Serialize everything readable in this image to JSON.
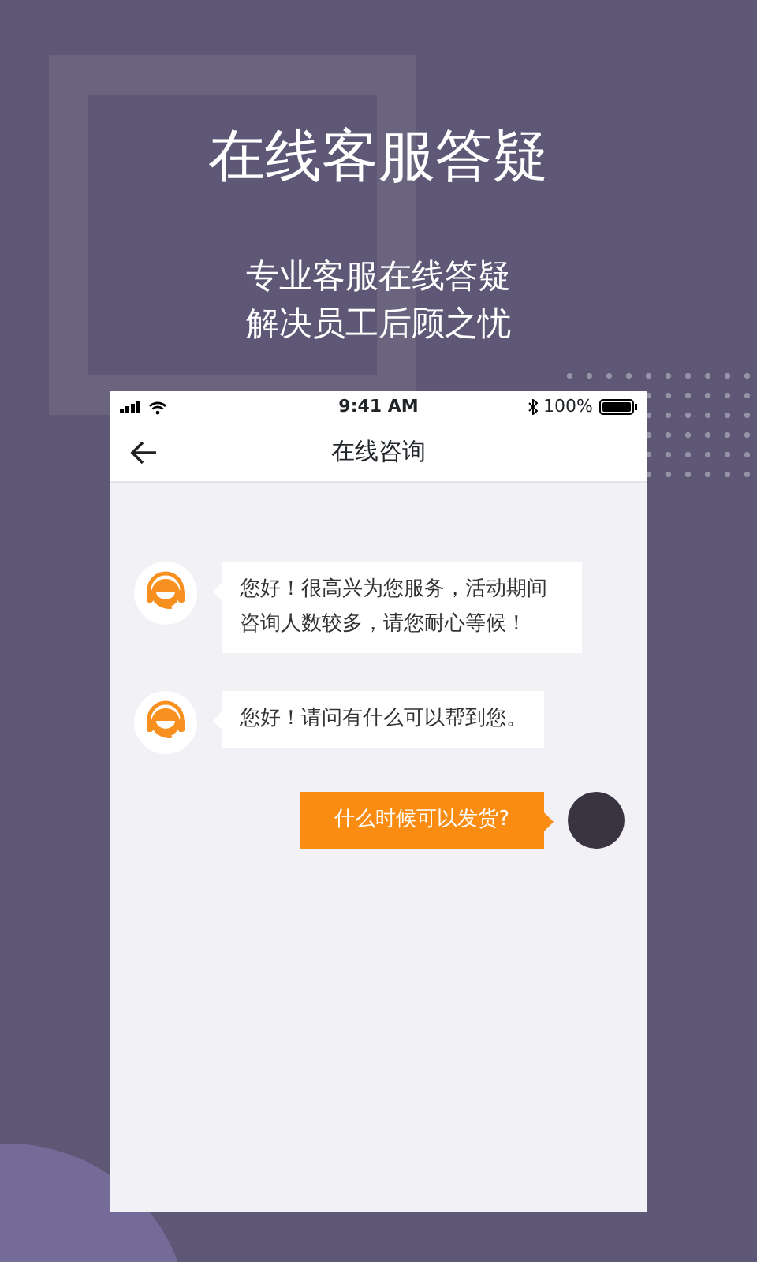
{
  "headline": "在线客服答疑",
  "subtitle_lines": [
    "专业客服在线答疑",
    "解决员工后顾之忧"
  ],
  "status_bar": {
    "time": "9:41 AM",
    "battery": "100%"
  },
  "header": {
    "title": "在线咨询"
  },
  "messages": [
    {
      "kind": "agent",
      "text": "您好！很高兴为您服务，活动期间咨询人数较多，请您耐心等候！"
    },
    {
      "kind": "agent",
      "text": "您好！请问有什么可以帮到您。"
    },
    {
      "kind": "user",
      "text": "什么时候可以发货?"
    }
  ]
}
